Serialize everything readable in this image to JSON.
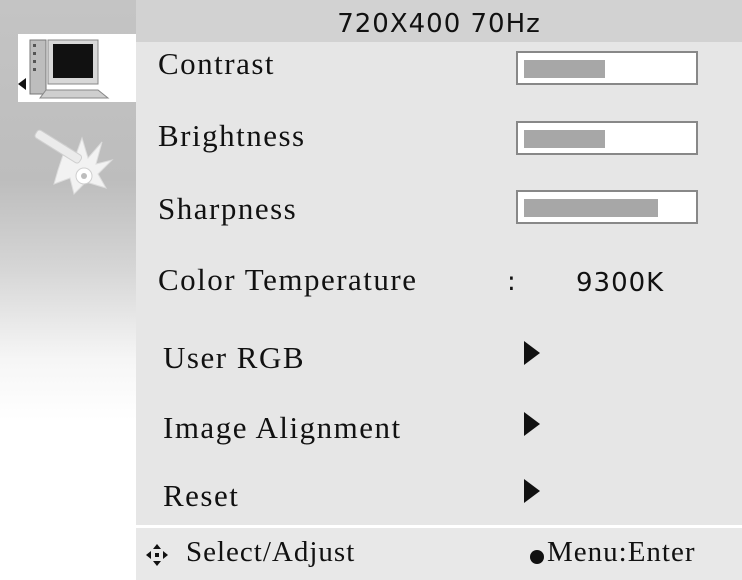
{
  "header": {
    "resolution": "720X400 70Hz"
  },
  "sidebar": {
    "tabs": [
      {
        "icon": "monitor-display-icon",
        "active": true
      },
      {
        "icon": "tools-wrench-icon",
        "active": false
      }
    ]
  },
  "menu": {
    "contrast": {
      "label": "Contrast",
      "level": 0.48
    },
    "brightness": {
      "label": "Brightness",
      "level": 0.48
    },
    "sharpness": {
      "label": "Sharpness",
      "level": 0.8
    },
    "color_temperature": {
      "label": "Color Temperature",
      "separator": ":",
      "value": "9300K"
    },
    "user_rgb": {
      "label": "User RGB"
    },
    "image_alignment": {
      "label": "Image Alignment"
    },
    "reset": {
      "label": "Reset"
    }
  },
  "footer": {
    "select_hint": "Select/Adjust",
    "menu_hint": "Menu:Enter"
  },
  "colors": {
    "panel": "#e6e6e6",
    "header": "#d2d2d2",
    "bar_fill": "#a7a7a7",
    "text": "#111111"
  }
}
